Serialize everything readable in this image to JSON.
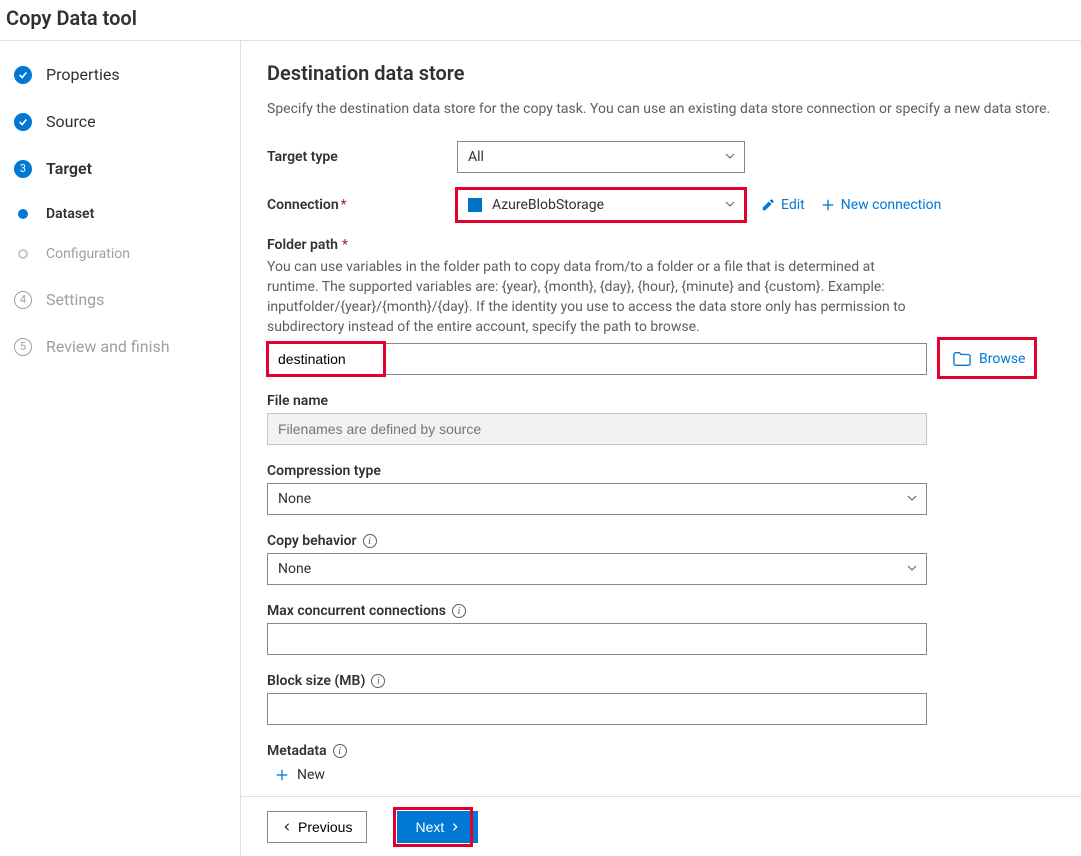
{
  "app": {
    "title": "Copy Data tool"
  },
  "wizard": {
    "steps": [
      {
        "label": "Properties"
      },
      {
        "label": "Source"
      },
      {
        "label": "Target"
      },
      {
        "label": "Dataset"
      },
      {
        "label": "Configuration"
      },
      {
        "label": "Settings"
      },
      {
        "label": "Review and finish"
      }
    ],
    "numbers": {
      "target": "3",
      "settings": "4",
      "review": "5"
    }
  },
  "page": {
    "title": "Destination data store",
    "subtitle": "Specify the destination data store for the copy task. You can use an existing data store connection or specify a new data store."
  },
  "form": {
    "target_type": {
      "label": "Target type",
      "value": "All"
    },
    "connection": {
      "label": "Connection",
      "value": "AzureBlobStorage",
      "edit": "Edit",
      "new": "New connection"
    },
    "folder_path": {
      "label": "Folder path",
      "help": "You can use variables in the folder path to copy data from/to a folder or a file that is determined at runtime. The supported variables are: {year}, {month}, {day}, {hour}, {minute} and {custom}. Example: inputfolder/{year}/{month}/{day}. If the identity you use to access the data store only has permission to subdirectory instead of the entire account, specify the path to browse.",
      "value": "destination",
      "browse": "Browse"
    },
    "file_name": {
      "label": "File name",
      "placeholder": "Filenames are defined by source"
    },
    "compression": {
      "label": "Compression type",
      "value": "None"
    },
    "copy_behavior": {
      "label": "Copy behavior",
      "value": "None"
    },
    "max_conn": {
      "label": "Max concurrent connections"
    },
    "block_size": {
      "label": "Block size (MB)"
    },
    "metadata": {
      "label": "Metadata",
      "new": "New"
    }
  },
  "footer": {
    "previous": "Previous",
    "next": "Next"
  }
}
